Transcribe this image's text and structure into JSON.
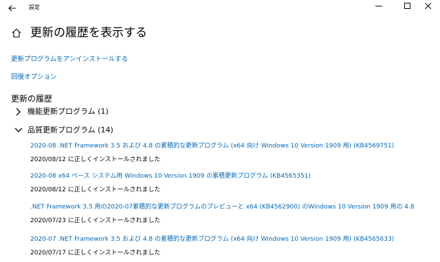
{
  "window": {
    "title": "設定",
    "back_icon": "back-arrow-icon",
    "controls": [
      "minimize-icon",
      "maximize-icon",
      "close-icon"
    ]
  },
  "page": {
    "home_icon": "home-icon",
    "title": "更新の履歴を表示する"
  },
  "links": {
    "uninstall": "更新プログラムをアンインストールする",
    "recovery": "回復オプション"
  },
  "history": {
    "title": "更新の履歴",
    "groups": [
      {
        "label": "機能更新プログラム (1)",
        "expanded": false
      },
      {
        "label": "品質更新プログラム (14)",
        "expanded": true
      }
    ],
    "updates": [
      {
        "title": "2020-08 .NET Framework 3.5 および 4.8 の累積的な更新プログラム (x64 向け Windows 10 Version 1909 用) (KB4569751)",
        "status": "2020/08/12 に正しくインストールされました"
      },
      {
        "title": "2020-08 x64 ベース システム用 Windows 10 Version 1909 の累積更新プログラム (KB4565351)",
        "status": "2020/08/12 に正しくインストールされました"
      },
      {
        "title": ".NET Framework 3.5 用の2020-07累積的な更新プログラムのプレビューと x64 (KB4562900) のWindows 10 Version 1909 用の 4.8",
        "status": "2020/07/23 に正しくインストールされました"
      },
      {
        "title": "2020-07 .NET Framework 3.5 および 4.8 の累積的な更新プログラム (x64 向け Windows 10 Version 1909 用) (KB4565633)",
        "status": "2020/07/17 に正しくインストールされました"
      }
    ]
  },
  "colors": {
    "link": "#0067b8",
    "text": "#000000",
    "background": "#ffffff"
  }
}
